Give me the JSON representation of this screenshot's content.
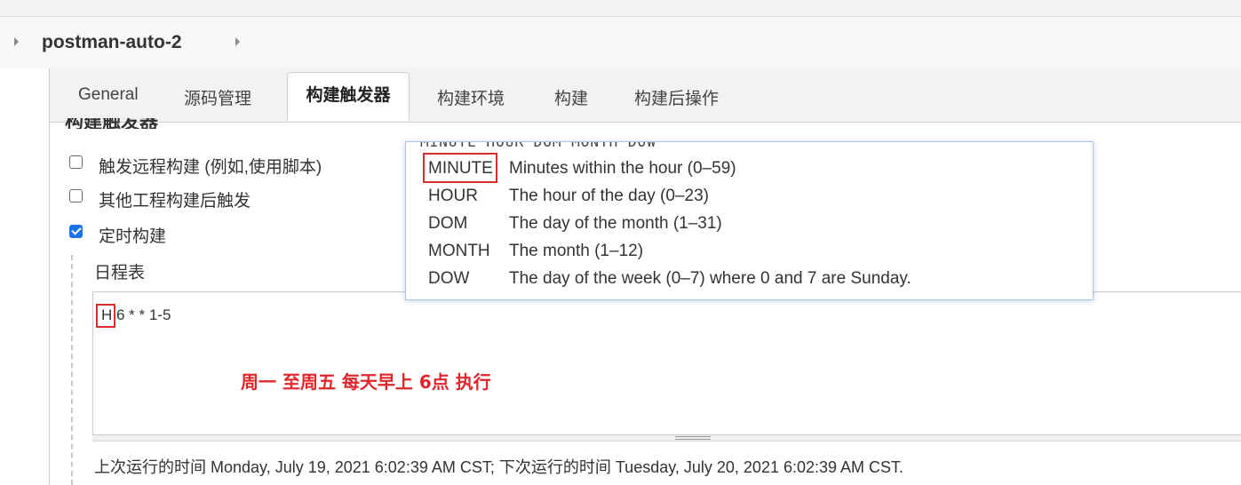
{
  "breadcrumb": {
    "title": "postman-auto-2"
  },
  "tabs": [
    {
      "label": "General"
    },
    {
      "label": "源码管理"
    },
    {
      "label": "构建触发器"
    },
    {
      "label": "构建环境"
    },
    {
      "label": "构建"
    },
    {
      "label": "构建后操作"
    }
  ],
  "active_tab": "构建触发器",
  "section_title": "构建触发器",
  "triggers": [
    {
      "label": "触发远程构建 (例如,使用脚本)",
      "checked": false
    },
    {
      "label": "其他工程构建后触发",
      "checked": false
    },
    {
      "label": "定时构建",
      "checked": true
    }
  ],
  "schedule": {
    "label": "日程表",
    "value": "H 6 * * 1-5",
    "annotation": "周一 至周五 每天早上 6点 执行",
    "run_info": "上次运行的时间 Monday, July 19, 2021 6:02:39 AM CST; 下次运行的时间 Tuesday, July 20, 2021 6:02:39 AM CST."
  },
  "tooltip": {
    "header": "MINUTE HOUR DOM MONTH DOW",
    "rows": [
      {
        "field": "MINUTE",
        "desc": "Minutes within the hour (0–59)"
      },
      {
        "field": "HOUR",
        "desc": "The hour of the day (0–23)"
      },
      {
        "field": "DOM",
        "desc": "The day of the month (1–31)"
      },
      {
        "field": "MONTH",
        "desc": "The month (1–12)"
      },
      {
        "field": "DOW",
        "desc": "The day of the week (0–7) where 0 and 7 are Sunday."
      }
    ]
  },
  "colors": {
    "highlight_red": "#d32f2f",
    "annotation_red": "#e0262b",
    "checkbox_blue": "#1a73e8"
  }
}
